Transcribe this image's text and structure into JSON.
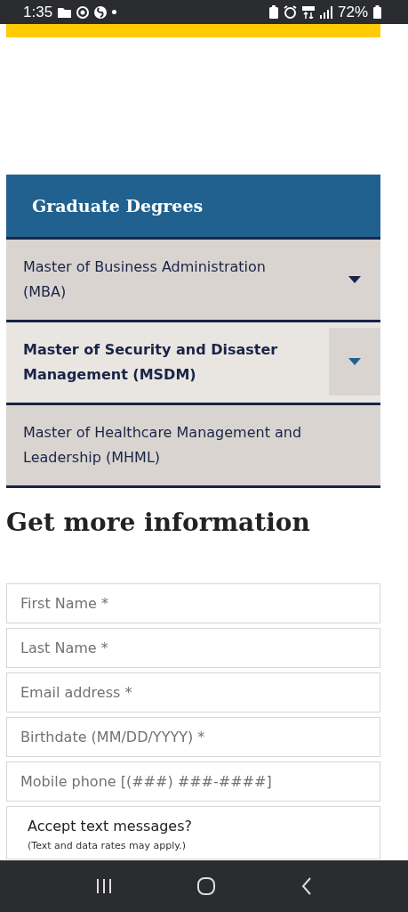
{
  "status_bar": {
    "time": "1:35",
    "battery": "72%"
  },
  "degrees": {
    "title": "Graduate Degrees",
    "items": [
      {
        "label": "Master of Business Administration (MBA)",
        "selected": false,
        "expandable": true
      },
      {
        "label": "Master of Security and Disaster Management (MSDM)",
        "selected": true,
        "expandable": true
      },
      {
        "label": "Master of Healthcare Management and Leadership (MHML)",
        "selected": false,
        "expandable": false
      }
    ]
  },
  "form": {
    "title": "Get more information",
    "fields": [
      {
        "placeholder": "First Name *"
      },
      {
        "placeholder": "Last Name *"
      },
      {
        "placeholder": "Email address *"
      },
      {
        "placeholder": "Birthdate (MM/DD/YYYY) *"
      },
      {
        "placeholder": "Mobile phone [(###) ###-####]"
      }
    ],
    "sms": {
      "question": "Accept text messages?",
      "note": "(Text and data rates may apply.)"
    }
  }
}
